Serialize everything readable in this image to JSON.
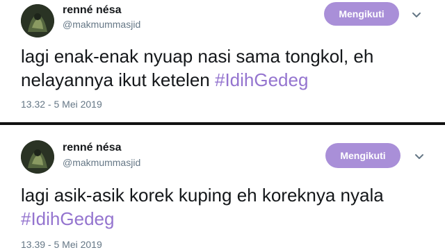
{
  "tweets": [
    {
      "display_name": "renné nésa",
      "handle": "@makmummasjid",
      "follow_label": "Mengikuti",
      "text": "lagi enak-enak nyuap nasi sama tongkol, eh nelayannya ikut ketelen",
      "hashtag": "#IdihGedeg",
      "timestamp": "13.32 - 5 Mei 2019"
    },
    {
      "display_name": "renné nésa",
      "handle": "@makmummasjid",
      "follow_label": "Mengikuti",
      "text": "lagi asik-asik korek kuping eh koreknya nyala",
      "hashtag": "#IdihGedeg",
      "timestamp": "13.39 - 5 Mei 2019"
    }
  ],
  "colors": {
    "accent": "#a98fd8",
    "hashtag": "#9474cf",
    "text": "#14171a",
    "muted": "#657786"
  },
  "icons": {
    "avatar": "avatar",
    "menu": "chevron-down-icon"
  }
}
